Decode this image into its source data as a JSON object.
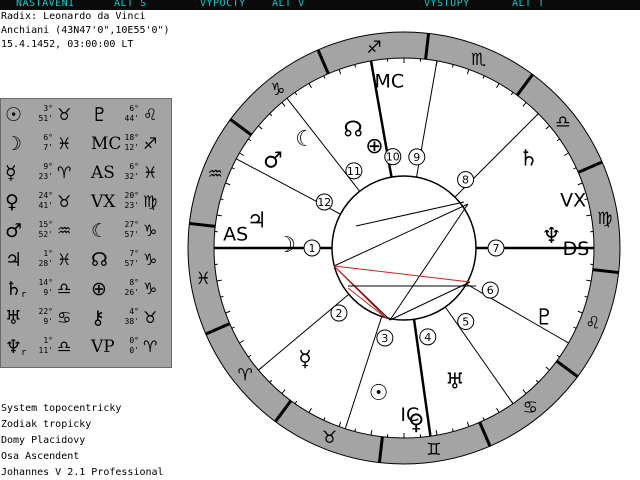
{
  "menu": [
    "NASTAVENI",
    "ALT S",
    "VYPOCTY",
    "ALT V",
    "VYSTUPY",
    "ALT T"
  ],
  "header": {
    "title": "Radix: Leonardo da Vinci",
    "place": "Anchiani (43N47'0\",10E55'0\")",
    "date": "15.4.1452, 03:00:00 LT"
  },
  "positions": [
    {
      "planet": "sun-icon",
      "glyph": "☉",
      "deg": "3°",
      "min": "51'",
      "sign": "taurus-icon",
      "sign_glyph": "♉",
      "retro": ""
    },
    {
      "planet": "moon-icon",
      "glyph": "☽",
      "deg": "6°",
      "min": "7'",
      "sign": "pisces-icon",
      "sign_glyph": "♓",
      "retro": ""
    },
    {
      "planet": "mercury-icon",
      "glyph": "☿",
      "deg": "9°",
      "min": "23'",
      "sign": "aries-icon",
      "sign_glyph": "♈",
      "retro": ""
    },
    {
      "planet": "venus-icon",
      "glyph": "♀",
      "deg": "24°",
      "min": "41'",
      "sign": "taurus-icon",
      "sign_glyph": "♉",
      "retro": ""
    },
    {
      "planet": "mars-icon",
      "glyph": "♂",
      "deg": "15°",
      "min": "52'",
      "sign": "aquarius-icon",
      "sign_glyph": "♒",
      "retro": ""
    },
    {
      "planet": "jupiter-icon",
      "glyph": "♃",
      "deg": "1°",
      "min": "28'",
      "sign": "pisces-icon",
      "sign_glyph": "♓",
      "retro": ""
    },
    {
      "planet": "saturn-icon",
      "glyph": "♄",
      "deg": "14°",
      "min": "9'",
      "sign": "libra-icon",
      "sign_glyph": "♎",
      "retro": "r"
    },
    {
      "planet": "uranus-icon",
      "glyph": "♅",
      "deg": "22°",
      "min": "9'",
      "sign": "cancer-icon",
      "sign_glyph": "♋",
      "retro": ""
    },
    {
      "planet": "neptune-icon",
      "glyph": "♆",
      "deg": "1°",
      "min": "11'",
      "sign": "libra-icon",
      "sign_glyph": "♎",
      "retro": "r"
    },
    {
      "planet": "pluto-icon",
      "glyph": "♇",
      "deg": "6°",
      "min": "44'",
      "sign": "leo-icon",
      "sign_glyph": "♌",
      "retro": ""
    },
    {
      "planet": "midheaven",
      "glyph": "MC",
      "deg": "18°",
      "min": "12'",
      "sign": "sagittarius-icon",
      "sign_glyph": "♐",
      "retro": ""
    },
    {
      "planet": "ascendant",
      "glyph": "AS",
      "deg": "6°",
      "min": "32'",
      "sign": "pisces-icon",
      "sign_glyph": "♓",
      "retro": ""
    },
    {
      "planet": "vertex",
      "glyph": "VX",
      "deg": "20°",
      "min": "23'",
      "sign": "virgo-icon",
      "sign_glyph": "♍",
      "retro": ""
    },
    {
      "planet": "lilith-icon",
      "glyph": "☾",
      "deg": "27°",
      "min": "57'",
      "sign": "capricorn-icon",
      "sign_glyph": "♑",
      "retro": ""
    },
    {
      "planet": "north-node-icon",
      "glyph": "☊",
      "deg": "7°",
      "min": "57'",
      "sign": "capricorn-icon",
      "sign_glyph": "♑",
      "retro": ""
    },
    {
      "planet": "part-of-fortune-icon",
      "glyph": "⊕",
      "deg": "8°",
      "min": "26'",
      "sign": "capricorn-icon",
      "sign_glyph": "♑",
      "retro": ""
    },
    {
      "planet": "chiron-icon",
      "glyph": "⚷",
      "deg": "4°",
      "min": "38'",
      "sign": "taurus-icon",
      "sign_glyph": "♉",
      "retro": ""
    },
    {
      "planet": "vertex-point",
      "glyph": "VP",
      "deg": "0°",
      "min": "0'",
      "sign": "aries-icon",
      "sign_glyph": "♈",
      "retro": ""
    }
  ],
  "footer": [
    "System topocentricky",
    "Zodiak tropicky",
    "Domy Placidovy",
    "Osa Ascendent",
    "Johannes V 2.1 Professional"
  ],
  "wheel": {
    "axis_labels": {
      "asc": "AS",
      "dsc": "DS",
      "mc": "MC",
      "ic": "IC",
      "vx": "VX"
    },
    "houses": [
      "1",
      "2",
      "3",
      "4",
      "5",
      "6",
      "7",
      "8",
      "9",
      "10",
      "11",
      "12"
    ],
    "zodiac_ring": [
      {
        "name": "sagittarius-icon",
        "glyph": "♐"
      },
      {
        "name": "scorpio-icon",
        "glyph": "♏"
      },
      {
        "name": "libra-icon",
        "glyph": "♎"
      },
      {
        "name": "virgo-icon",
        "glyph": "♍"
      },
      {
        "name": "leo-icon",
        "glyph": "♌"
      },
      {
        "name": "cancer-icon",
        "glyph": "♋"
      },
      {
        "name": "gemini-icon",
        "glyph": "♊"
      },
      {
        "name": "taurus-icon",
        "glyph": "♉"
      },
      {
        "name": "aries-icon",
        "glyph": "♈"
      },
      {
        "name": "pisces-icon",
        "glyph": "♓"
      },
      {
        "name": "aquarius-icon",
        "glyph": "♒"
      },
      {
        "name": "capricorn-icon",
        "glyph": "♑"
      }
    ],
    "planet_glyphs": [
      {
        "name": "north-node-icon",
        "glyph": "☊"
      },
      {
        "name": "part-of-fortune-icon",
        "glyph": "⊕"
      },
      {
        "name": "lilith-icon",
        "glyph": "☾"
      },
      {
        "name": "mars-icon",
        "glyph": "♂"
      },
      {
        "name": "jupiter-icon",
        "glyph": "♃"
      },
      {
        "name": "moon-icon",
        "glyph": "☽"
      },
      {
        "name": "mercury-icon",
        "glyph": "☿"
      },
      {
        "name": "sun-icon",
        "glyph": "☉"
      },
      {
        "name": "venus-icon",
        "glyph": "♀"
      },
      {
        "name": "uranus-icon",
        "glyph": "♅"
      },
      {
        "name": "pluto-icon",
        "glyph": "♇"
      },
      {
        "name": "neptune-icon",
        "glyph": "♆"
      },
      {
        "name": "saturn-icon",
        "glyph": "♄"
      }
    ],
    "aspect_colors": {
      "harmonic": "#000000",
      "tense": "#d02020"
    }
  }
}
